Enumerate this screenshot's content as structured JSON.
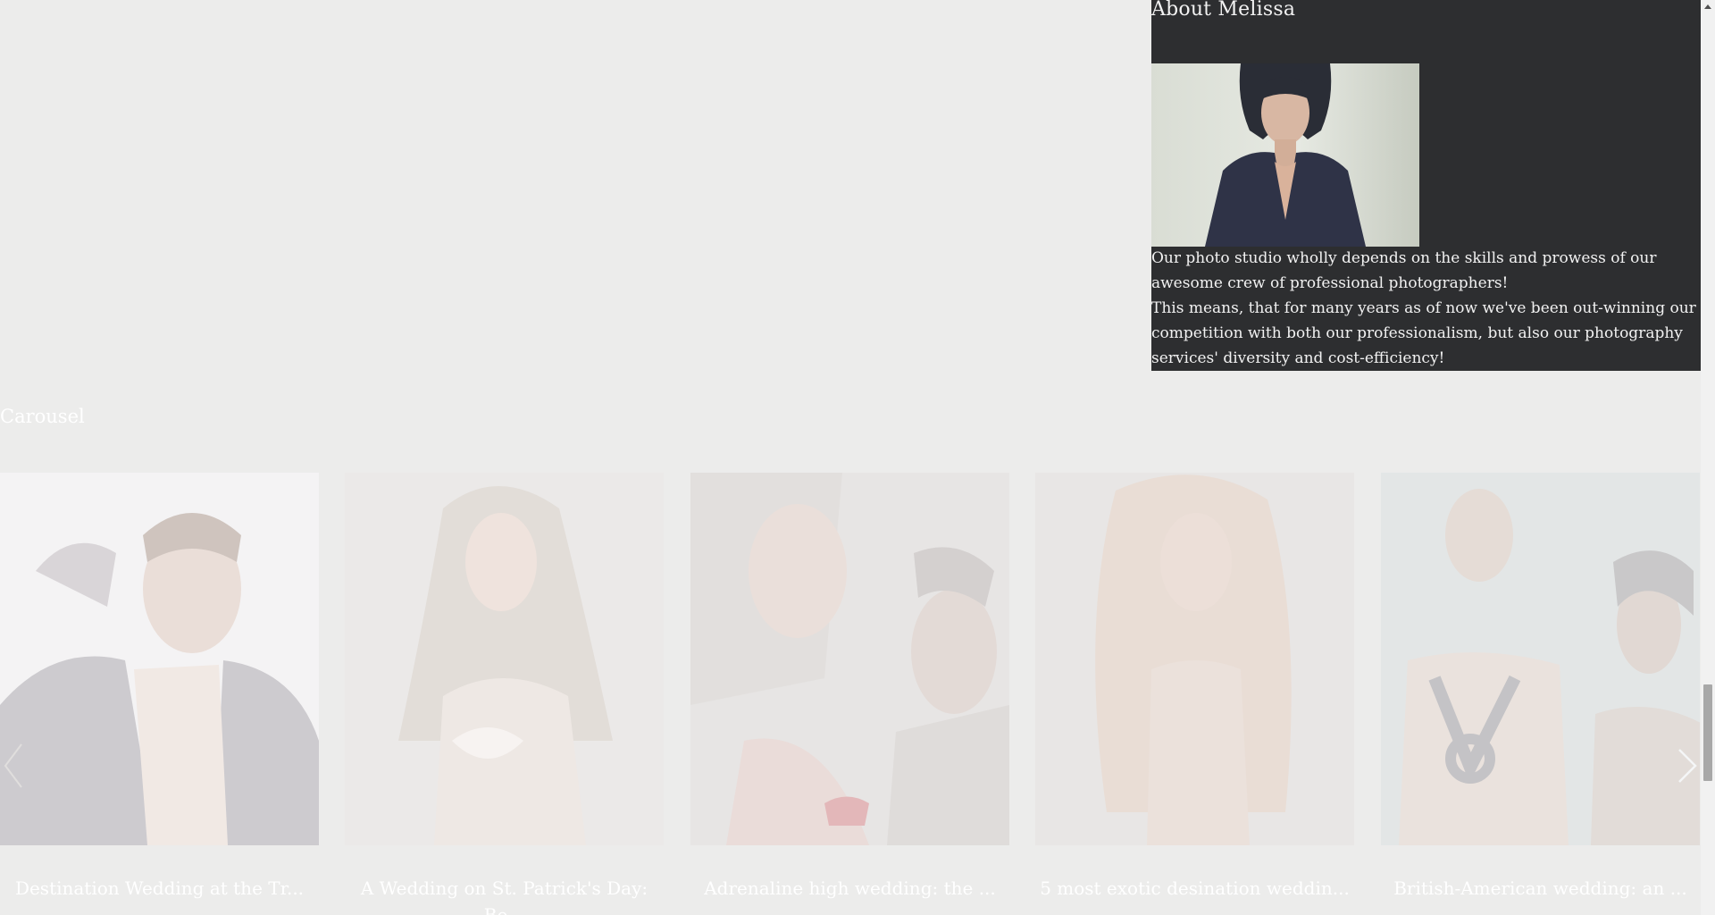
{
  "about": {
    "title": "About Melissa",
    "paragraphs": [
      "Our photo studio wholly depends on the skills and prowess of our awesome crew of professional photographers!",
      "This means, that for many years as of now we've been out-winning our competition with both our professionalism, but also our photography services' diversity and cost-efficiency!"
    ]
  },
  "carousel": {
    "title": "Carousel",
    "slides": [
      {
        "caption": "Destination Wedding at the Tr..."
      },
      {
        "caption": "A Wedding on St. Patrick's Day: Bo..."
      },
      {
        "caption": "Adrenaline high wedding: the ..."
      },
      {
        "caption": "5 most exotic desination weddin..."
      },
      {
        "caption": "British-American wedding: an ..."
      }
    ],
    "prev_icon": "chevron-left-icon",
    "next_icon": "chevron-right-icon"
  },
  "colors": {
    "page_bg": "#ececeb",
    "panel_bg": "#2d2e30",
    "text_light": "#ffffff"
  }
}
